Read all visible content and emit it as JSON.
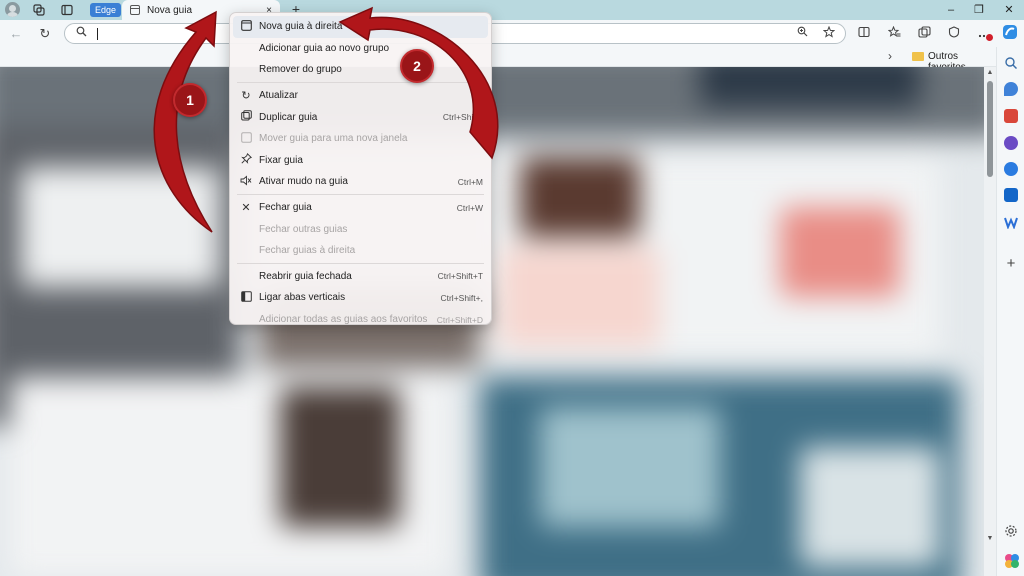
{
  "tabstrip": {
    "edge_label": "Edge",
    "active_tab_title": "Nova guia",
    "tab_close": "×",
    "new_tab": "+",
    "minimize": "–",
    "maximize": "❐",
    "close": "✕"
  },
  "toolbar": {
    "back": "←",
    "refresh": "↻",
    "address_value": ""
  },
  "favorites_bar": {
    "chevron": "›",
    "folder_label": "Outros favoritos"
  },
  "context_menu": {
    "items": [
      {
        "label": "Nova guia à direita",
        "shortcut": "",
        "disabled": false,
        "highlighted": true
      },
      {
        "label": "Adicionar guia ao novo grupo",
        "shortcut": "",
        "disabled": false
      },
      {
        "label": "Remover do grupo",
        "shortcut": "",
        "disabled": false
      },
      {
        "label": "Atualizar",
        "shortcut": "C",
        "disabled": false
      },
      {
        "label": "Duplicar guia",
        "shortcut": "Ctrl+Shift+",
        "disabled": false
      },
      {
        "label": "Mover guia para uma nova janela",
        "shortcut": "",
        "disabled": true
      },
      {
        "label": "Fixar guia",
        "shortcut": "",
        "disabled": false
      },
      {
        "label": "Ativar mudo na guia",
        "shortcut": "Ctrl+M",
        "disabled": false
      },
      {
        "label": "Fechar guia",
        "shortcut": "Ctrl+W",
        "disabled": false
      },
      {
        "label": "Fechar outras guias",
        "shortcut": "",
        "disabled": true
      },
      {
        "label": "Fechar guias à direita",
        "shortcut": "",
        "disabled": true
      },
      {
        "label": "Reabrir guia fechada",
        "shortcut": "Ctrl+Shift+T",
        "disabled": false
      },
      {
        "label": "Ligar abas verticais",
        "shortcut": "Ctrl+Shift+,",
        "disabled": false
      },
      {
        "label": "Adicionar todas as guias aos favoritos",
        "shortcut": "Ctrl+Shift+D",
        "disabled": true
      }
    ]
  },
  "annotations": {
    "step1": "1",
    "step2": "2",
    "arrow_color": "#b0161a"
  },
  "colors": {
    "tabstrip": "#b9d9df",
    "toolbar": "#f4f7f9",
    "edge_badge": "#3a7fd5",
    "annotation": "#9a1518"
  }
}
